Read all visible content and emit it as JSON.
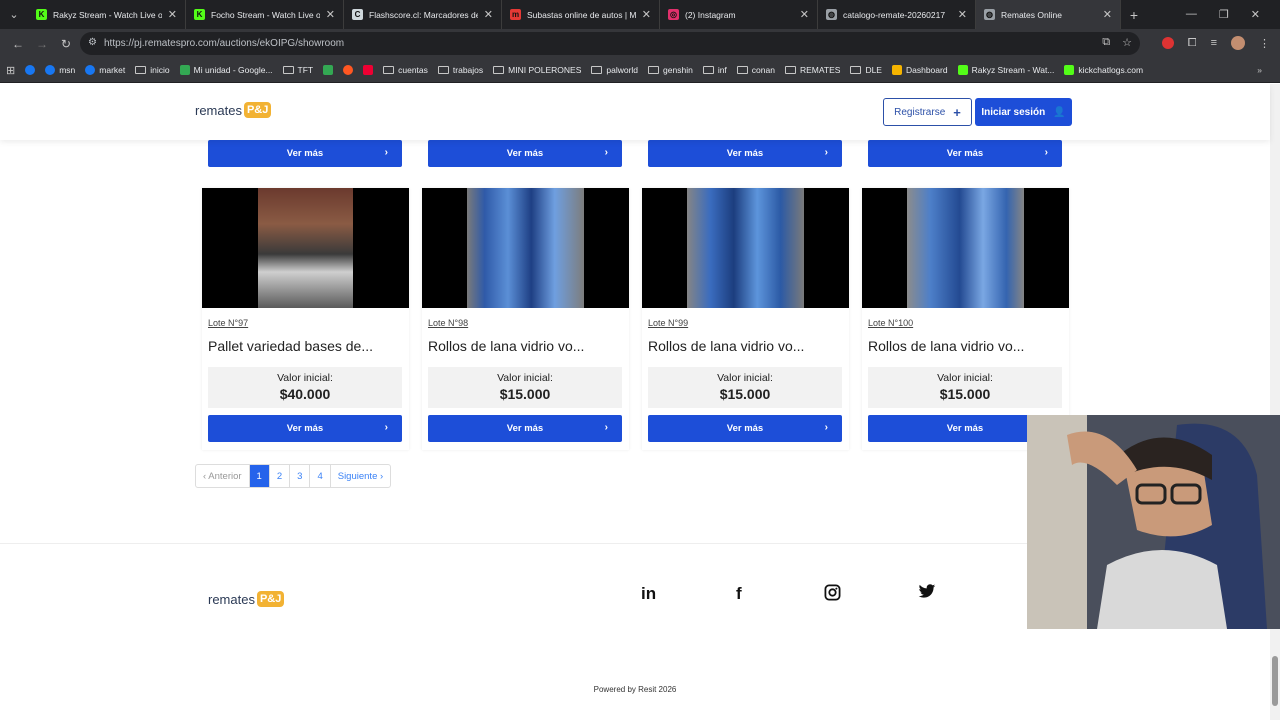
{
  "browser": {
    "tabs": [
      {
        "title": "Rakyz Stream - Watch Live on K",
        "icon_color": "#53fc18",
        "icon": "K"
      },
      {
        "title": "Focho Stream - Watch Live on K",
        "icon_color": "#53fc18",
        "icon": "K"
      },
      {
        "title": "Flashscore.cl: Marcadores de fú",
        "icon_color": "#cfd8dc",
        "icon": "C"
      },
      {
        "title": "Subastas online de autos | Mac",
        "icon_color": "#e53935",
        "icon": "m"
      },
      {
        "title": "(2) Instagram",
        "icon_color": "#e1306c",
        "icon": "◎"
      },
      {
        "title": "catalogo-remate-20260217",
        "icon_color": "#9aa0a6",
        "icon": "◍"
      },
      {
        "title": "Remates Online",
        "icon_color": "#9aa0a6",
        "icon": "◍"
      }
    ],
    "url": "https://pj.rematespro.com/auctions/ekOIPG/showroom",
    "bookmarks": [
      {
        "label": "",
        "type": "fb"
      },
      {
        "label": "msn",
        "type": "fb"
      },
      {
        "label": "market",
        "type": "fb"
      },
      {
        "label": "inicio",
        "type": "folder"
      },
      {
        "label": "Mi unidad - Google...",
        "type": "g"
      },
      {
        "label": "TFT",
        "type": "folder"
      },
      {
        "label": "",
        "type": "g"
      },
      {
        "label": "",
        "type": "o"
      },
      {
        "label": "",
        "type": "r"
      },
      {
        "label": "cuentas",
        "type": "folder"
      },
      {
        "label": "trabajos",
        "type": "folder"
      },
      {
        "label": "MINI POLERONES",
        "type": "folder"
      },
      {
        "label": "palworld",
        "type": "folder"
      },
      {
        "label": "genshin",
        "type": "folder"
      },
      {
        "label": "inf",
        "type": "folder"
      },
      {
        "label": "conan",
        "type": "folder"
      },
      {
        "label": "REMATES",
        "type": "folder"
      },
      {
        "label": "DLE",
        "type": "folder"
      },
      {
        "label": "Dashboard",
        "type": "y"
      },
      {
        "label": "Rakyz Stream - Wat...",
        "type": "k"
      },
      {
        "label": "kickchatlogs.com",
        "type": "k"
      }
    ]
  },
  "header": {
    "logo_text": "remates",
    "logo_badge": "P&J",
    "register_label": "Registrarse",
    "login_label": "Iniciar sesión"
  },
  "top_buttons": [
    "Ver más",
    "Ver más",
    "Ver más",
    "Ver más"
  ],
  "lots": [
    {
      "lote": "Lote N°97",
      "title": "Pallet variedad bases de...",
      "valor_label": "Valor inicial:",
      "valor": "$40.000",
      "button": "Ver más"
    },
    {
      "lote": "Lote N°98",
      "title": "Rollos de lana vidrio vo...",
      "valor_label": "Valor inicial:",
      "valor": "$15.000",
      "button": "Ver más"
    },
    {
      "lote": "Lote N°99",
      "title": "Rollos de lana vidrio vo...",
      "valor_label": "Valor inicial:",
      "valor": "$15.000",
      "button": "Ver más"
    },
    {
      "lote": "Lote N°100",
      "title": "Rollos de lana vidrio vo...",
      "valor_label": "Valor inicial:",
      "valor": "$15.000",
      "button": "Ver más"
    }
  ],
  "pagination": {
    "prev": "‹ Anterior",
    "pages": [
      "1",
      "2",
      "3",
      "4"
    ],
    "current": "1",
    "next": "Siguiente ›"
  },
  "footer": {
    "logo_text": "remates",
    "logo_badge": "P&J",
    "social": [
      "linkedin-icon",
      "facebook-icon",
      "instagram-icon",
      "twitter-icon"
    ],
    "powered": "Powered by Resit 2026"
  },
  "colors": {
    "primary": "#1d4ed8",
    "badge": "#f2b233"
  }
}
